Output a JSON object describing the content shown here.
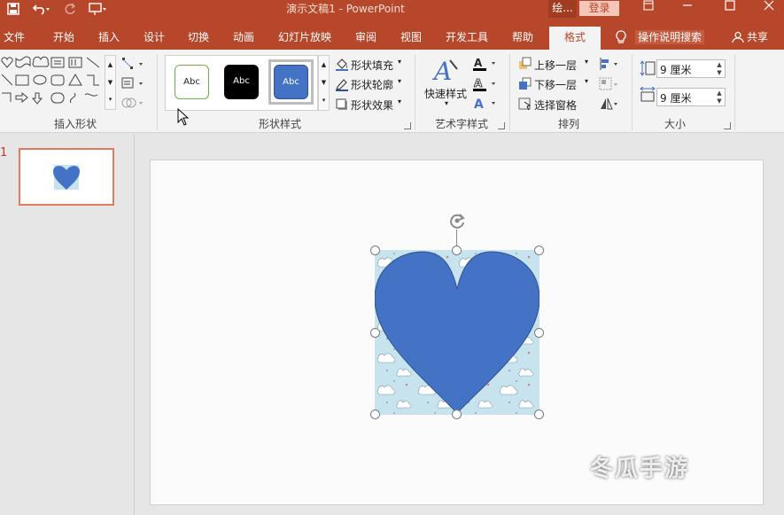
{
  "window": {
    "title": "演示文稿1  -  PowerPoint",
    "context_tab": "绘...",
    "login": "登录"
  },
  "tabs": [
    {
      "label": "文件"
    },
    {
      "label": "开始"
    },
    {
      "label": "插入"
    },
    {
      "label": "设计"
    },
    {
      "label": "切换"
    },
    {
      "label": "动画"
    },
    {
      "label": "幻灯片放映"
    },
    {
      "label": "审阅"
    },
    {
      "label": "视图"
    },
    {
      "label": "开发工具"
    },
    {
      "label": "帮助"
    },
    {
      "label": "格式"
    }
  ],
  "tell_me": "操作说明搜索",
  "share": "共享",
  "ribbon": {
    "insert_shapes": {
      "label": "插入形状"
    },
    "shape_styles": {
      "label": "形状样式",
      "presets": [
        "Abc",
        "Abc",
        "Abc"
      ],
      "fill": "形状填充",
      "outline": "形状轮廓",
      "effects": "形状效果"
    },
    "wordart": {
      "label": "艺术字样式",
      "quick": "快速样式"
    },
    "arrange": {
      "label": "排列",
      "forward": "上移一层",
      "backward": "下移一层",
      "pane": "选择窗格"
    },
    "size": {
      "label": "大小",
      "height": "9 厘米",
      "width": "9 厘米"
    }
  },
  "slides": {
    "number": "1"
  },
  "colors": {
    "accent": "#b7472a",
    "heart": "#4472c4",
    "pattern_bg": "#c6e3ee"
  },
  "watermark": "冬瓜手游"
}
